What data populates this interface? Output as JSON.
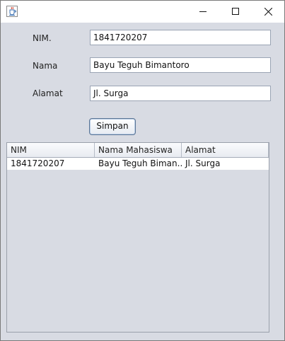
{
  "window": {
    "title": "",
    "icon": "java-cup-icon"
  },
  "form": {
    "nim_label": "NIM.",
    "nim_value": "1841720207",
    "nama_label": "Nama",
    "nama_value": "Bayu Teguh Bimantoro",
    "alamat_label": "Alamat",
    "alamat_value": "Jl. Surga",
    "save_label": "Simpan"
  },
  "table": {
    "columns": [
      "NIM",
      "Nama Mahasiswa",
      "Alamat"
    ],
    "rows": [
      [
        "1841720207",
        "Bayu Teguh Biman...",
        "Jl. Surga"
      ]
    ]
  }
}
